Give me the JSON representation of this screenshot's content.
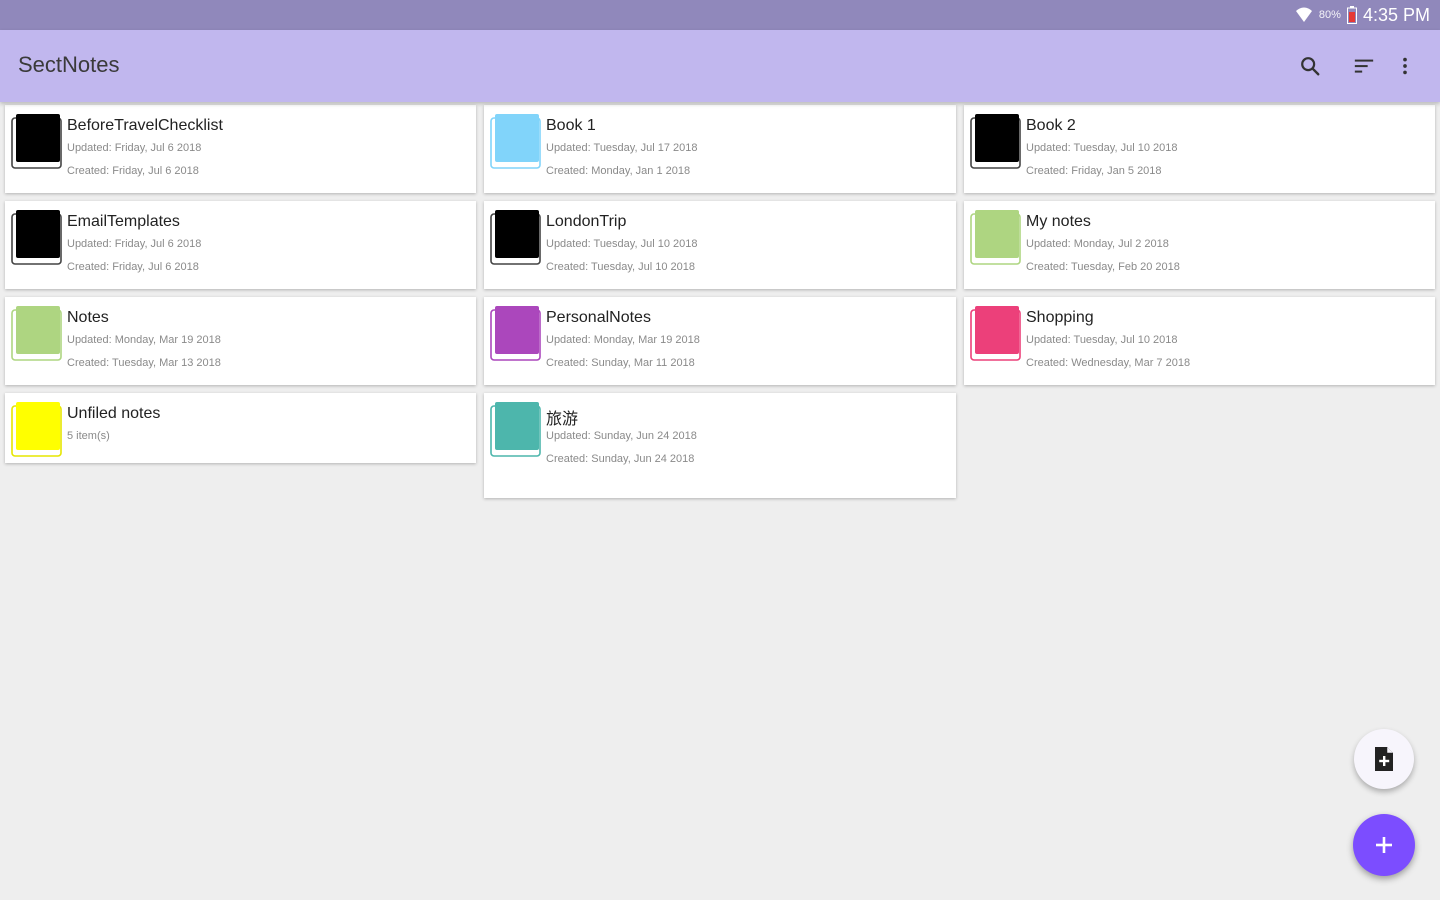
{
  "status_bar": {
    "battery_text": "80%",
    "time": "4:35 PM"
  },
  "app_bar": {
    "title": "SectNotes",
    "icons": [
      "search-icon",
      "sort-icon",
      "more-vert-icon"
    ]
  },
  "notebooks": [
    {
      "title": "BeforeTravelChecklist",
      "line1": "Updated: Friday, Jul 6 2018",
      "line2": "Created: Friday, Jul 6 2018",
      "color": "#000000"
    },
    {
      "title": "Book 1",
      "line1": "Updated: Tuesday, Jul 17 2018",
      "line2": "Created: Monday, Jan 1 2018",
      "color": "#81d4fa"
    },
    {
      "title": "Book 2",
      "line1": "Updated: Tuesday, Jul 10 2018",
      "line2": "Created: Friday, Jan 5 2018",
      "color": "#000000"
    },
    {
      "title": "EmailTemplates",
      "line1": "Updated: Friday, Jul 6 2018",
      "line2": "Created: Friday, Jul 6 2018",
      "color": "#000000"
    },
    {
      "title": "LondonTrip",
      "line1": "Updated: Tuesday, Jul 10 2018",
      "line2": "Created: Tuesday, Jul 10 2018",
      "color": "#000000"
    },
    {
      "title": "My notes",
      "line1": "Updated: Monday, Jul 2 2018",
      "line2": "Created: Tuesday, Feb 20 2018",
      "color": "#aed581"
    },
    {
      "title": "Notes",
      "line1": "Updated: Monday, Mar 19 2018",
      "line2": "Created: Tuesday, Mar 13 2018",
      "color": "#aed581"
    },
    {
      "title": "PersonalNotes",
      "line1": "Updated: Monday, Mar 19 2018",
      "line2": "Created: Sunday, Mar 11 2018",
      "color": "#ab47bc"
    },
    {
      "title": "Shopping",
      "line1": "Updated: Tuesday, Jul 10 2018",
      "line2": "Created: Wednesday, Mar 7 2018",
      "color": "#ec407a"
    },
    {
      "title": "Unfiled notes",
      "line1": "5 item(s)",
      "line2": "",
      "color": "#ffff00"
    },
    {
      "title": "旅游",
      "line1": "Updated: Sunday, Jun 24 2018",
      "line2": "Created: Sunday, Jun 24 2018",
      "color": "#4db6ac"
    }
  ],
  "fab": {
    "secondary_icon": "add-note-icon",
    "primary_icon": "plus-icon",
    "primary_color": "#7c4dff"
  }
}
